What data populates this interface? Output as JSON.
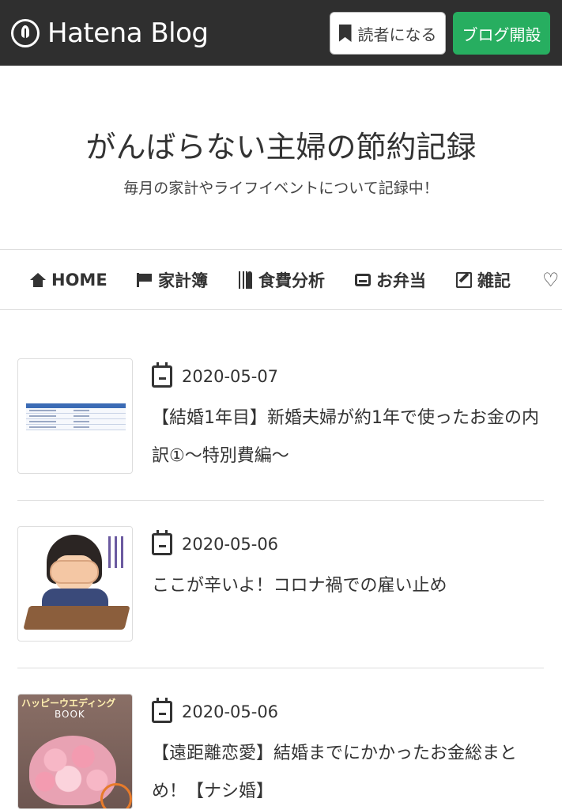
{
  "topbar": {
    "brand": "Hatena Blog",
    "reader_button": "読者になる",
    "open_blog_button": "ブログ開設"
  },
  "header": {
    "title": "がんばらない主婦の節約記録",
    "description": "毎月の家計やライフイベントについて記録中！"
  },
  "nav": {
    "items": [
      {
        "label": "HOME",
        "icon": "home-icon"
      },
      {
        "label": "家計簿",
        "icon": "flag-icon"
      },
      {
        "label": "食費分析",
        "icon": "cutlery-icon"
      },
      {
        "label": "お弁当",
        "icon": "inbox-icon"
      },
      {
        "label": "雑記",
        "icon": "edit-icon"
      },
      {
        "label": "",
        "icon": "heart-icon"
      }
    ]
  },
  "posts": [
    {
      "date": "2020-05-07",
      "title": "【結婚1年目】新婚夫婦が約1年で使ったお金の内訳①〜特別費編〜",
      "thumbnail": "spreadsheet-image"
    },
    {
      "date": "2020-05-06",
      "title": "ここが辛いよ！コロナ禍での雇い止め",
      "thumbnail": "worried-person-illustration"
    },
    {
      "date": "2020-05-06",
      "title": "【遠距離恋愛】結婚までにかかったお金総まとめ！【ナシ婚】",
      "thumbnail": "wedding-book-image"
    }
  ],
  "thumb3": {
    "title": "ハッピーウエディング",
    "subtitle": "BOOK"
  },
  "colors": {
    "topbar_bg": "#2f2f2f",
    "accent_green": "#27ae60"
  }
}
